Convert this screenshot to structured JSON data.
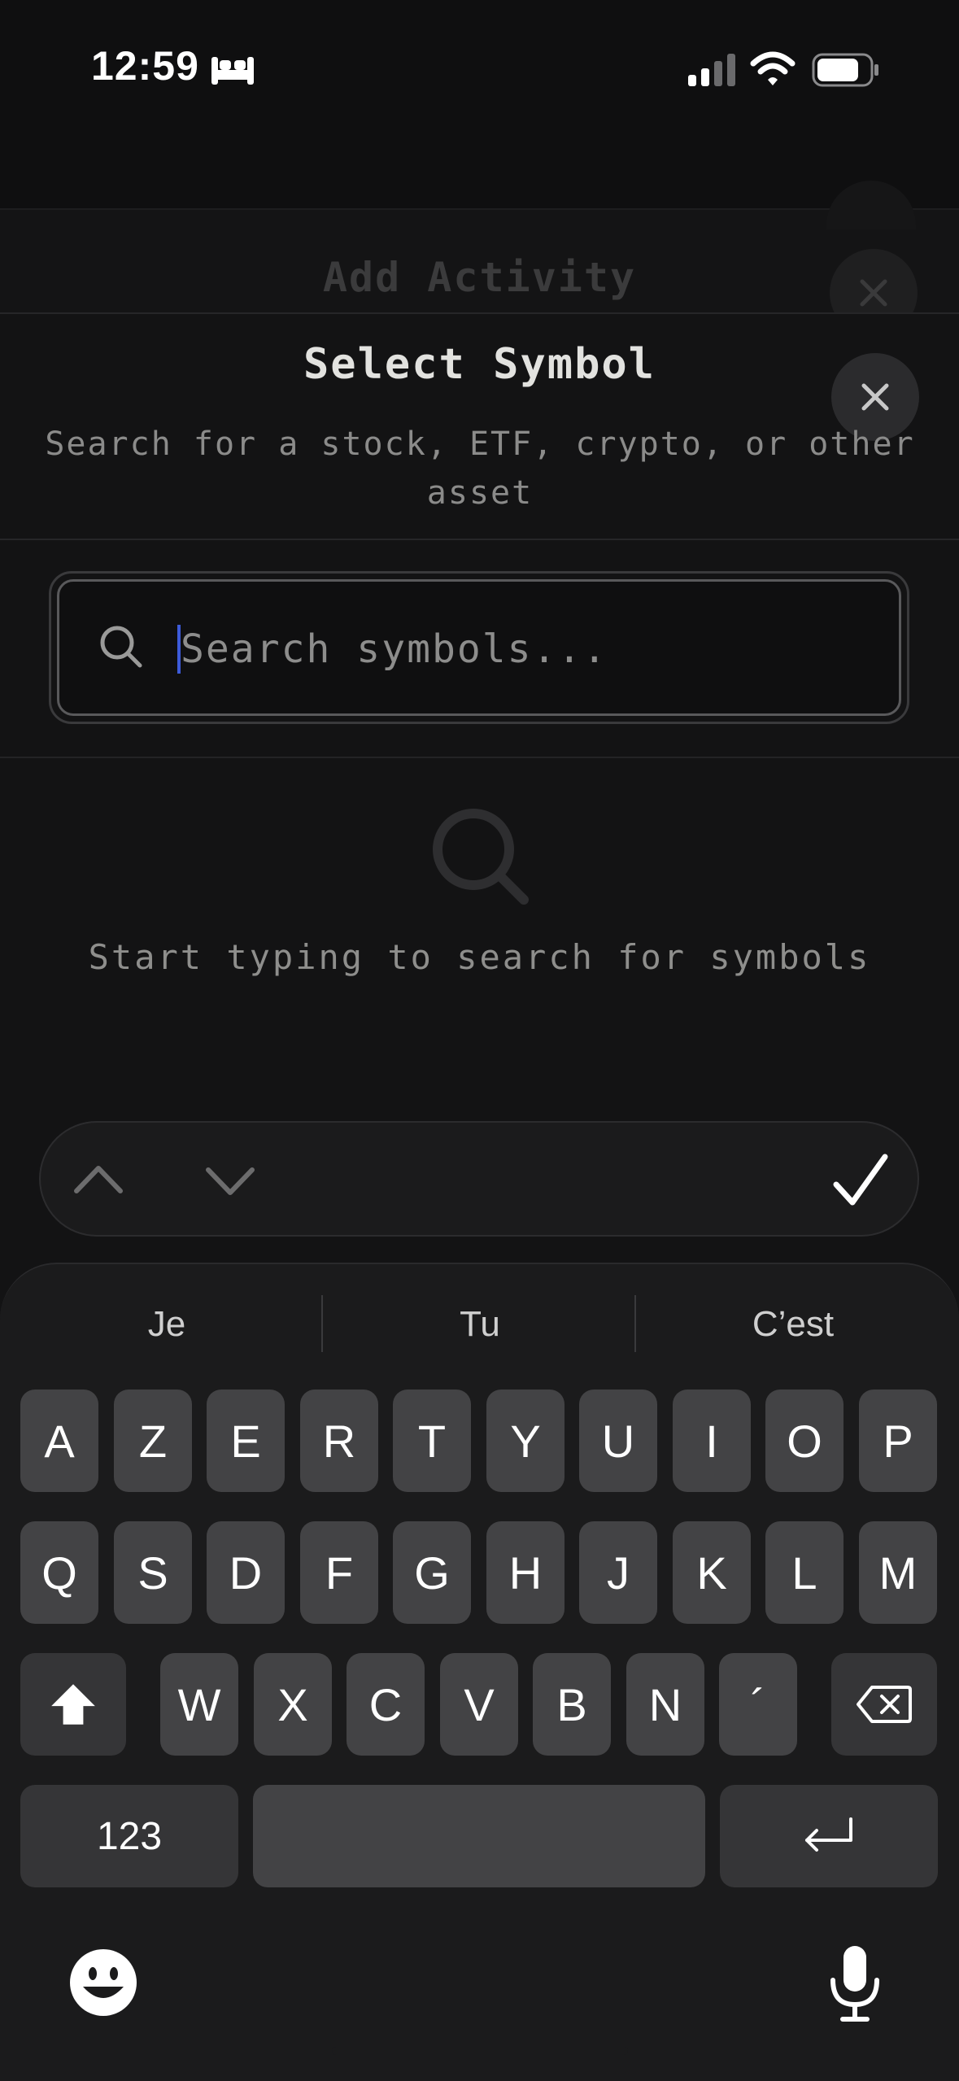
{
  "status_bar": {
    "time": "12:59"
  },
  "background_sheet": {
    "title": "Add Activity"
  },
  "sheet": {
    "title": "Select Symbol",
    "subtitle": "Search for a stock, ETF, crypto, or other asset",
    "search": {
      "placeholder": "Search symbols...",
      "value": ""
    },
    "empty_state": {
      "message": "Start typing to search for symbols"
    }
  },
  "keyboard": {
    "suggestions": [
      "Je",
      "Tu",
      "C’est"
    ],
    "row1": [
      "A",
      "Z",
      "E",
      "R",
      "T",
      "Y",
      "U",
      "I",
      "O",
      "P"
    ],
    "row2": [
      "Q",
      "S",
      "D",
      "F",
      "G",
      "H",
      "J",
      "K",
      "L",
      "M"
    ],
    "row3": [
      "W",
      "X",
      "C",
      "V",
      "B",
      "N",
      "´"
    ],
    "numbers_label": "123"
  },
  "colors": {
    "background": "#0f0f10",
    "sheet": "#131314",
    "key": "#434345",
    "caret": "#3d5bd9"
  }
}
